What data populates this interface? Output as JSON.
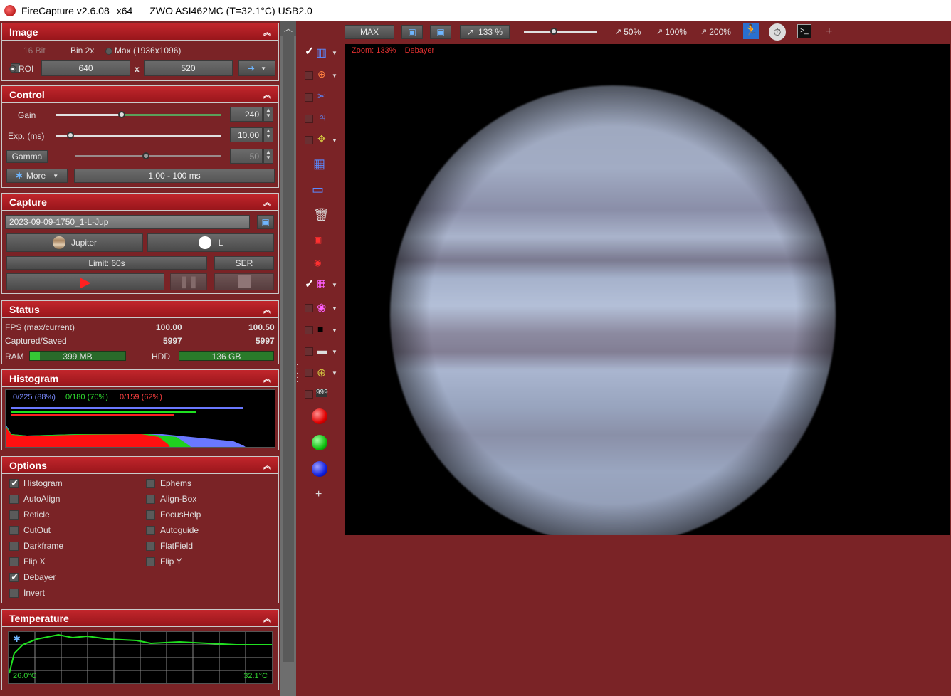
{
  "window": {
    "app": "FireCapture v2.6.08",
    "arch": "x64",
    "camera": "ZWO ASI462MC (T=32.1°C) USB2.0"
  },
  "image_panel": {
    "title": "Image",
    "bit16": "16 Bit",
    "bin2x": "Bin 2x",
    "max": "Max (1936x1096)",
    "roi": "ROI",
    "roi_w": "640",
    "x_sep": "x",
    "roi_h": "520"
  },
  "control_panel": {
    "title": "Control",
    "gain_label": "Gain",
    "gain_value": "240",
    "exp_label": "Exp. (ms)",
    "exp_value": "10.00",
    "gamma_label": "Gamma",
    "gamma_value": "50",
    "more_label": "More",
    "exp_range": "1.00 - 100 ms"
  },
  "capture_panel": {
    "title": "Capture",
    "filename": "2023-09-09-1750_1-L-Jup",
    "object": "Jupiter",
    "filter": "L",
    "limit": "Limit: 60s",
    "format": "SER"
  },
  "status_panel": {
    "title": "Status",
    "fps_label": "FPS (max/current)",
    "fps_max": "100.00",
    "fps_cur": "100.50",
    "cap_label": "Captured/Saved",
    "captured": "5997",
    "saved": "5997",
    "ram_label": "RAM",
    "ram_value": "399 MB",
    "hdd_label": "HDD",
    "hdd_value": "136 GB"
  },
  "histogram_panel": {
    "title": "Histogram",
    "blue": "0/225 (88%)",
    "green": "0/180 (70%)",
    "red": "0/159 (62%)"
  },
  "options_panel": {
    "title": "Options",
    "left": [
      {
        "label": "Histogram",
        "checked": true
      },
      {
        "label": "AutoAlign",
        "checked": false
      },
      {
        "label": "Reticle",
        "checked": false
      },
      {
        "label": "CutOut",
        "checked": false
      },
      {
        "label": "Darkframe",
        "checked": false
      },
      {
        "label": "Flip X",
        "checked": false
      },
      {
        "label": "Debayer",
        "checked": true
      },
      {
        "label": "Invert",
        "checked": false
      }
    ],
    "right": [
      {
        "label": "Ephems",
        "checked": false
      },
      {
        "label": "Align-Box",
        "checked": false
      },
      {
        "label": "FocusHelp",
        "checked": false
      },
      {
        "label": "Autoguide",
        "checked": false
      },
      {
        "label": "FlatField",
        "checked": false
      },
      {
        "label": "Flip Y",
        "checked": false
      }
    ]
  },
  "temperature_panel": {
    "title": "Temperature",
    "min": "26.0°C",
    "max": "32.1°C"
  },
  "toolbar": {
    "max": "MAX",
    "zoom": "133 %",
    "z50": "50%",
    "z100": "100%",
    "z200": "200%"
  },
  "viewer": {
    "zoom_info": "Zoom: 133%",
    "debayer_info": "Debayer"
  },
  "colors": {
    "panel_header": "#b01f25",
    "background": "#7a2326",
    "accent_green": "#21c21b"
  }
}
